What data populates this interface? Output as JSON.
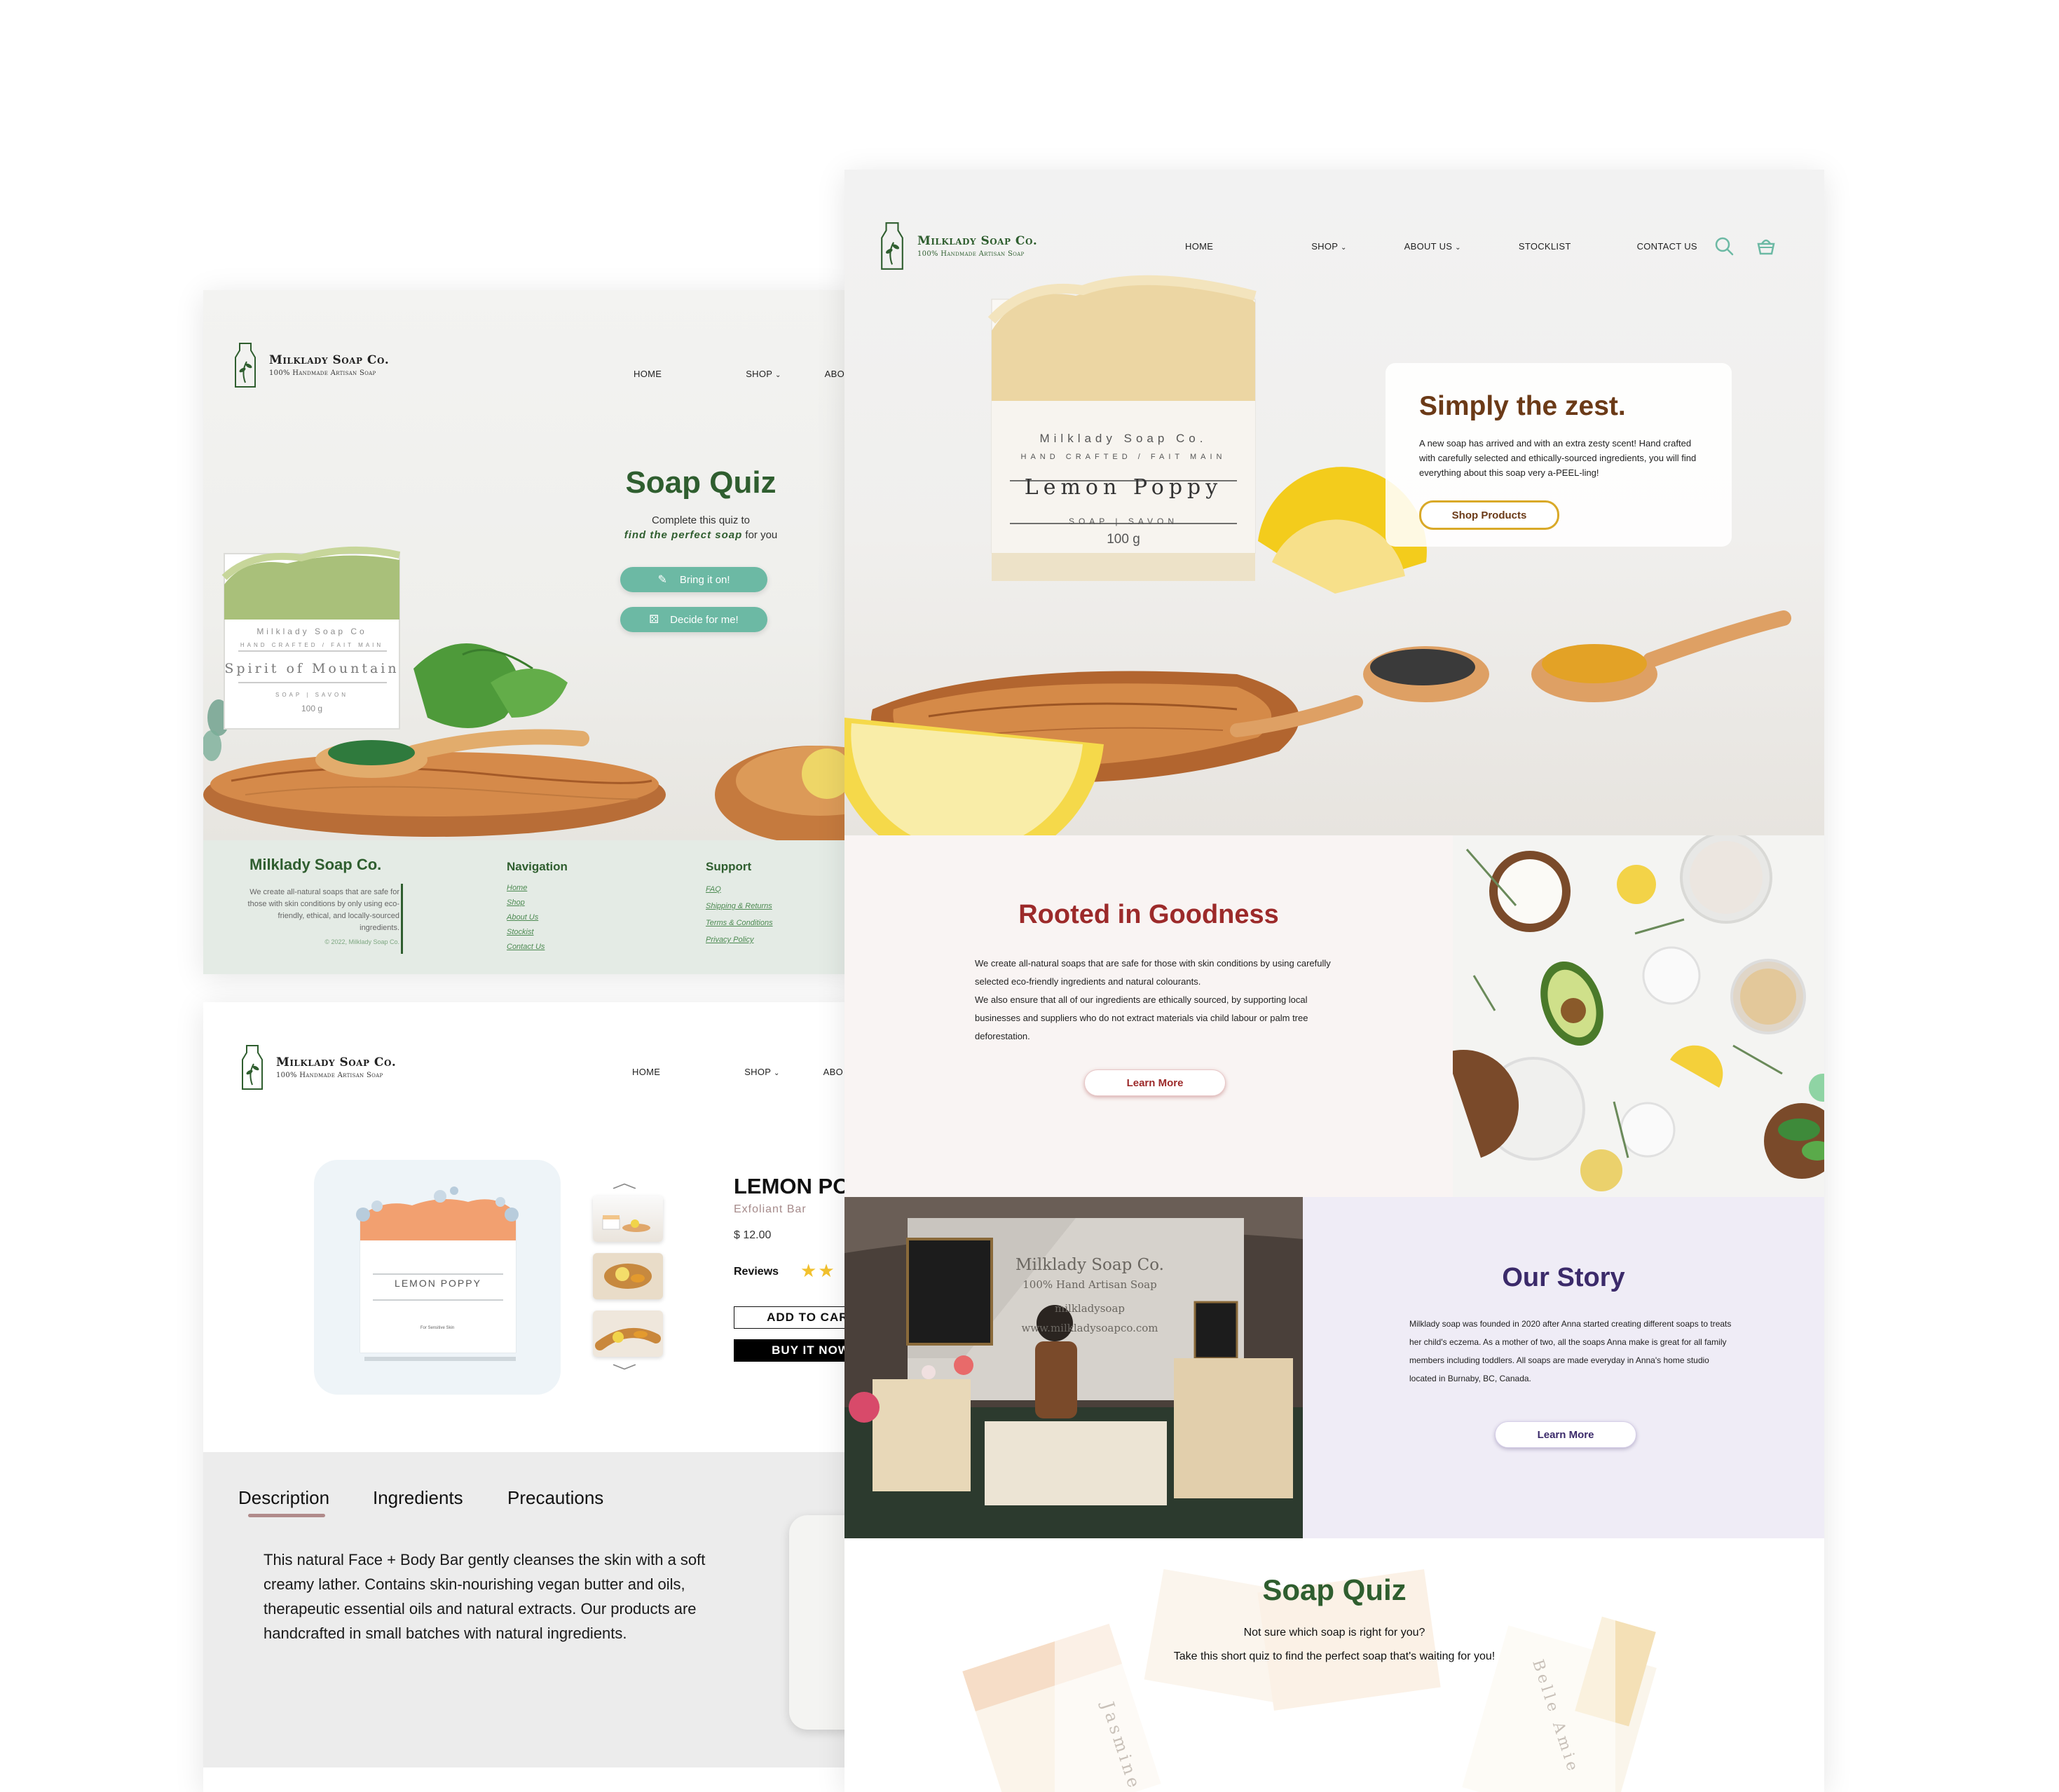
{
  "brand": {
    "name": "Milklady Soap Co.",
    "tagline": "100% Handmade Artisan Soap",
    "accent_green": "#2f5e2f",
    "accent_teal": "#6cb9a4",
    "accent_gold": "#d9a928",
    "accent_red": "#9c2a2a",
    "accent_purple": "#3b2a6a"
  },
  "quiz_page": {
    "nav": {
      "home": "HOME",
      "shop": "SHOP",
      "about": "ABOU"
    },
    "hero": {
      "title": "Soap Quiz",
      "line1": "Complete this quiz to",
      "line2_em": "find the perfect soap",
      "line2_rest": "for you",
      "btn_bring": "Bring it on!",
      "btn_decide": "Decide for me!"
    },
    "soap_label": {
      "brand": "Milklady Soap Co",
      "crafted": "HAND CRAFTED / FAIT MAIN",
      "name": "Spirit of Mountain",
      "type": "SOAP | SAVON",
      "weight": "100 g"
    },
    "footer": {
      "brand": "Milklady Soap Co.",
      "about": "We create all-natural soaps that are safe for those with skin conditions by only using eco-friendly, ethical, and locally-sourced ingredients.",
      "copyright": "© 2022, Milklady Soap Co.",
      "nav_title": "Navigation",
      "nav_links": [
        "Home",
        "Shop",
        "About Us",
        "Stockist",
        "Contact Us"
      ],
      "support_title": "Support",
      "support_links": [
        "FAQ",
        "Shipping & Returns",
        "Terms & Conditions",
        "Privacy Policy"
      ]
    }
  },
  "product_page": {
    "nav": {
      "home": "HOME",
      "shop": "SHOP",
      "about": "ABO"
    },
    "product": {
      "image_label": "LEMON POPPY",
      "image_sub": "For Sensitive Skin",
      "title": "LEMON PO",
      "subtitle": "Exfoliant Bar",
      "price": "$ 12.00",
      "reviews_label": "Reviews",
      "rating": 2,
      "add_to_cart": "ADD TO CART",
      "buy_now": "BUY IT NOW"
    },
    "tabs": [
      "Description",
      "Ingredients",
      "Precautions"
    ],
    "description": "This natural Face + Body Bar gently cleanses the skin with a soft creamy lather. Contains skin-nourishing vegan butter and oils, therapeutic essential oils and natural extracts. Our products are handcrafted in small batches with natural ingredients."
  },
  "home_page": {
    "nav": {
      "home": "HOME",
      "shop": "SHOP",
      "about": "ABOUT US",
      "stocklist": "STOCKLIST",
      "contact": "CONTACT US"
    },
    "hero": {
      "title": "Simply the zest.",
      "body": "A new soap has arrived and with an extra zesty scent! Hand crafted with carefully selected and ethically-sourced ingredients, you will find everything about this soap very a-PEEL-ling!",
      "cta": "Shop Products"
    },
    "soap_label": {
      "brand": "Milklady Soap Co.",
      "crafted": "HAND CRAFTED / FAIT MAIN",
      "name": "Lemon Poppy",
      "type": "SOAP | SAVON",
      "weight": "100 g"
    },
    "rooted": {
      "title": "Rooted in Goodness",
      "p1": "We create all-natural soaps that are safe for those with skin conditions by using carefully selected eco-friendly ingredients and natural colourants.",
      "p2": "We also ensure that all of our ingredients are ethically sourced, by supporting local businesses and suppliers who do not extract materials via child labour or palm tree deforestation.",
      "cta": "Learn More"
    },
    "story": {
      "title": "Our Story",
      "body": "Milklady soap was founded in 2020 after Anna started creating different soaps to treats her child's eczema. As a mother of two, all the soaps Anna make is great for all family members including toddlers. All soaps are made everyday in Anna's home studio located in Burnaby, BC, Canada.",
      "cta": "Learn More",
      "banner_line1": "Milklady Soap Co.",
      "banner_line2": "100% Hand Artisan Soap",
      "banner_line3": "milkladysoap",
      "banner_line4": "www.milkladysoapco.com"
    },
    "quiz": {
      "title": "Soap Quiz",
      "line1": "Not sure which soap is right for you?",
      "line2": "Take this short quiz to find the perfect soap that's waiting for you!",
      "soap_left": "Jasmine",
      "soap_right": "Belle Amie"
    }
  }
}
